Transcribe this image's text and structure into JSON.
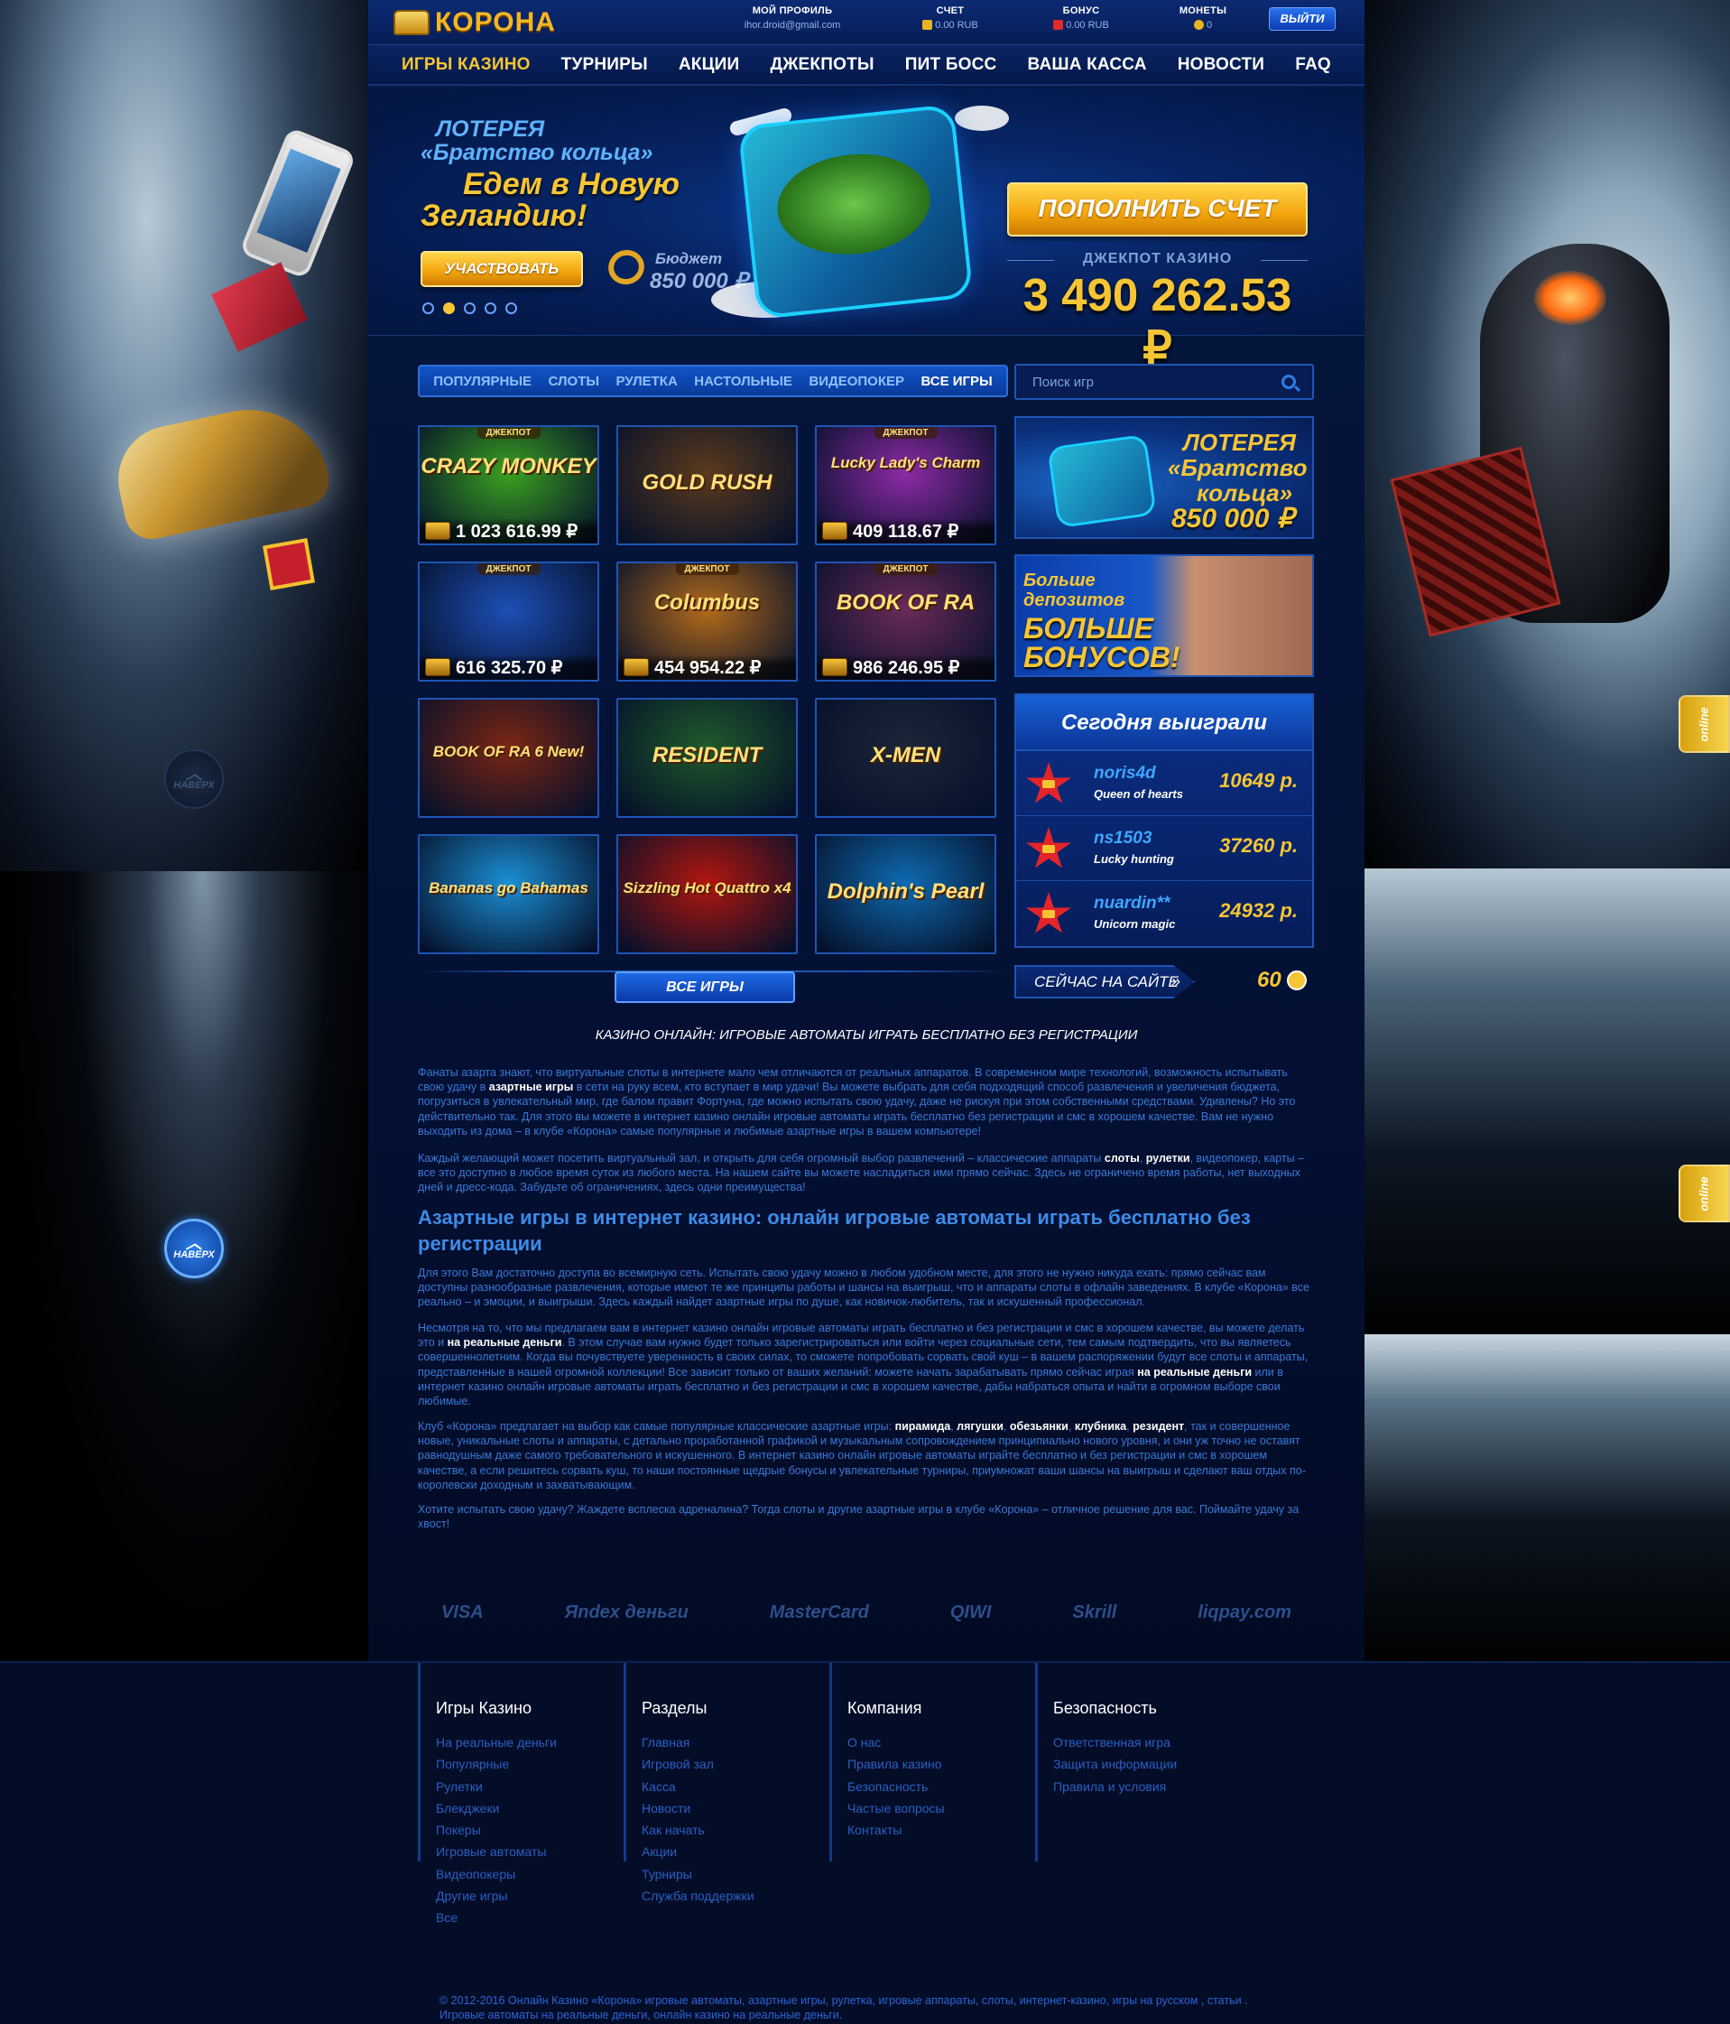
{
  "header": {
    "logo": "КОРОНА",
    "profile_label": "МОЙ ПРОФИЛЬ",
    "profile_email": "ihor.droid@gmail.com",
    "account_label": "СЧЕТ",
    "account_value": "0.00 RUB",
    "bonus_label": "БОНУС",
    "bonus_value": "0.00 RUB",
    "coins_label": "МОНЕТЫ",
    "coins_value": "0",
    "logout": "ВЫЙТИ"
  },
  "nav": [
    "ИГРЫ КАЗИНО",
    "ТУРНИРЫ",
    "АКЦИИ",
    "ДЖЕКПОТЫ",
    "ПИТ БОСС",
    "ВАША КАССА",
    "НОВОСТИ",
    "FAQ"
  ],
  "hero": {
    "line1": "ЛОТЕРЕЯ",
    "line2": "«Братство кольца»",
    "line3": "Едем в Новую",
    "line4": "Зеландию!",
    "join_button": "УЧАСТВОВАТЬ",
    "budget_label": "Бюджет",
    "budget_value": "850 000 ₽",
    "deposit_button": "ПОПОЛНИТЬ СЧЕТ",
    "jackpot_label": "ДЖЕКПОТ КАЗИНО",
    "jackpot_value": "3 490 262.53 ₽",
    "slide_count": 5,
    "active_slide": 2
  },
  "game_tabs": [
    "ПОПУЛЯРНЫЕ",
    "СЛОТЫ",
    "РУЛЕТКА",
    "НАСТОЛЬНЫЕ",
    "ВИДЕОПОКЕР",
    "ВСЕ ИГРЫ"
  ],
  "search_placeholder": "Поиск игр",
  "jackpot_badge": "ДЖЕКПОТ",
  "games": [
    {
      "name": "CRAZY MONKEY",
      "jackpot": "1 023 616.99 ₽",
      "bg": "#3aa020"
    },
    {
      "name": "GOLD RUSH",
      "jackpot": "",
      "bg": "#5b3a1c"
    },
    {
      "name": "Lucky Lady's Charm",
      "jackpot": "409 118.67 ₽",
      "bg": "#8c2aa6"
    },
    {
      "name": "",
      "jackpot": "616 325.70 ₽",
      "bg": "#1d4fb6"
    },
    {
      "name": "Columbus",
      "jackpot": "454 954.22 ₽",
      "bg": "#b36a1a"
    },
    {
      "name": "BOOK OF RA",
      "jackpot": "986 246.95 ₽",
      "bg": "#6a2a58"
    },
    {
      "name": "BOOK OF RA 6 New!",
      "jackpot": "",
      "bg": "#7a2614"
    },
    {
      "name": "RESIDENT",
      "jackpot": "",
      "bg": "#1f5a2a"
    },
    {
      "name": "X-MEN",
      "jackpot": "",
      "bg": "#1c2538"
    },
    {
      "name": "Bananas go Bahamas",
      "jackpot": "",
      "bg": "#1b8fd4"
    },
    {
      "name": "Sizzling Hot Quattro x4",
      "jackpot": "",
      "bg": "#b2160e"
    },
    {
      "name": "Dolphin's Pearl",
      "jackpot": "",
      "bg": "#0e6ab0"
    }
  ],
  "all_games_button": "ВСЕ ИГРЫ",
  "promo_lottery": {
    "t1": "ЛОТЕРЕЯ",
    "t2": "«Братство",
    "t3": "кольца»",
    "t4": "850 000 ₽"
  },
  "promo_bonus": {
    "t1": "Больше",
    "t2": "депозитов",
    "t3": "БОЛЬШЕ",
    "t4": "БОНУСОВ!"
  },
  "winners": {
    "title": "Сегодня выиграли",
    "rows": [
      {
        "user": "noris4d",
        "game": "Queen of hearts",
        "amount": "10649 р."
      },
      {
        "user": "ns1503",
        "game": "Lucky hunting",
        "amount": "37260 р."
      },
      {
        "user": "nuardin**",
        "game": "Unicorn magic",
        "amount": "24932 р."
      }
    ]
  },
  "on_site_label": "СЕЙЧАС НА САЙТЕ",
  "on_site_count": "60",
  "up_button": "НАВЕРХ",
  "online_tab": "online",
  "seo": {
    "title": "КАЗИНО ОНЛАЙН: ИГРОВЫЕ АВТОМАТЫ ИГРАТЬ БЕСПЛАТНО БЕЗ РЕГИСТРАЦИИ",
    "p1a": "Фанаты азарта знают, что виртуальные слоты в интернете мало чем отличаются от реальных аппаратов. В современном мире технологий, возможность испытывать свою удачу в ",
    "p1b": "азартные игры",
    "p1c": " в сети на руку всем, кто вступает в мир удачи! Вы можете выбрать для себя подходящий способ развлечения и увеличения бюджета, погрузиться в увлекательный мир, где балом правит Фортуна, где можно испытать свою удачу, даже не рискуя при этом собственными средствами. Удивлены? Но это действительно так. Для этого вы можете в интернет казино онлайн игровые автоматы играть бесплатно без регистрации и смс в хорошем качестве. Вам не нужно выходить из дома – в клубе «Корона» самые популярные и любимые азартные игры в вашем компьютере!",
    "p2a": "Каждый желающий может посетить виртуальный зал, и открыть для себя огромный выбор развлечений – классические аппараты ",
    "p2b": "слоты",
    "p2c": ", ",
    "p2d": "рулетки",
    "p2e": ", видеопокер, карты – все это доступно в любое время суток из любого места. На нашем сайте вы можете насладиться ими прямо сейчас. Здесь не ограничено время работы, нет выходных дней и дресс-кода. Забудьте об ограничениях, здесь одни преимущества!",
    "heading": "Азартные игры в интернет казино: онлайн игровые автоматы играть бесплатно без регистрации",
    "p3": "Для этого Вам достаточно доступа во всемирную сеть. Испытать свою удачу можно в любом удобном месте, для этого не нужно никуда ехать: прямо сейчас вам доступны разнообразные развлечения, которые имеют те же принципы работы и шансы на выигрыш, что и аппараты слоты в офлайн заведениях. В клубе «Корона» все реально – и эмоции, и выигрыши. Здесь каждый найдет азартные игры по душе, как новичок-любитель, так и искушенный профессионал.",
    "p4a": "Несмотря на то, что мы предлагаем вам в интернет казино онлайн игровые автоматы играть бесплатно и без регистрации и смс в хорошем качестве, вы можете делать это и ",
    "p4b": "на реальные деньги",
    "p4c": ". В этом случае вам нужно будет только зарегистрироваться или войти через социальные сети, тем самым подтвердить, что вы являетесь совершеннолетним. Когда вы почувствуете уверенность в своих силах, то сможете попробовать сорвать свой куш – в вашем распоряжении будут все слоты и аппараты, представленные в нашей огромной коллекции! Все зависит только от ваших желаний: можете начать зарабатывать прямо сейчас играя ",
    "p4d": "на реальные деньги",
    "p4e": " или в интернет казино онлайн игровые автоматы играть бесплатно и без регистрации и смс в хорошем качестве, дабы набраться опыта и найти в огромном выборе свои любимые.",
    "p5a": "Клуб «Корона» предлагает на выбор как самые популярные классические азартные игры: ",
    "p5b": "пирамида",
    "p5c": ", ",
    "p5d": "лягушки",
    "p5e": ", ",
    "p5f": "обезьянки",
    "p5g": ", ",
    "p5h": "клубника",
    "p5i": ", ",
    "p5j": "резидент",
    "p5k": ", так и совершенное новые, уникальные слоты и аппараты, с детально проработанной графикой и музыкальным сопровождением принципиально нового уровня, и они уж точно не оставят равнодушным даже самого требовательного и искушенного. В интернет казино онлайн игровые автоматы играйте бесплатно и без регистрации и смс в хорошем качестве, а если решитесь сорвать куш, то наши постоянные щедрые бонусы и увлекательные турниры, приумножат ваши шансы на выигрыш и сделают ваш отдых по-королевски доходным и захватывающим.",
    "p6": "Хотите испытать свою удачу? Жаждете всплеска адреналина? Тогда слоты и другие азартные игры в клубе «Корона» – отличное решение для вас. Поймайте удачу за хвост!"
  },
  "payments": [
    "VISA",
    "Яndex деньги",
    "MasterCard",
    "QIWI",
    "Skrill",
    "liqpay.com"
  ],
  "footer": {
    "cols": [
      {
        "title": "Игры Казино",
        "links": [
          "На реальные деньги",
          "Популярные",
          "Рулетки",
          "Блекджеки",
          "Покеры",
          "Игровые автоматы",
          "Видеопокеры",
          "Другие игры",
          "Все"
        ]
      },
      {
        "title": "Разделы",
        "links": [
          "Главная",
          "Игровой зал",
          "Касса",
          "Новости",
          "Как начать",
          "Акции",
          "Турниры",
          "Служба поддержки"
        ]
      },
      {
        "title": "Компания",
        "links": [
          "О нас",
          "Правила казино",
          "Безопасность",
          "Частые вопросы",
          "Контакты"
        ]
      },
      {
        "title": "Безопасность",
        "links": [
          "Ответственная игра",
          "Защита информации",
          "Правила и условия"
        ]
      }
    ],
    "copyright1": "© 2012-2016 Онлайн Казино «Корона» игровые автоматы, азартные игры, рулетка, игровые аппараты, слоты, интернет-казино, игры на русском , статьи .",
    "copyright2": "Игровые автоматы на реальные деньги, онлайн казино на реальные деньги."
  }
}
